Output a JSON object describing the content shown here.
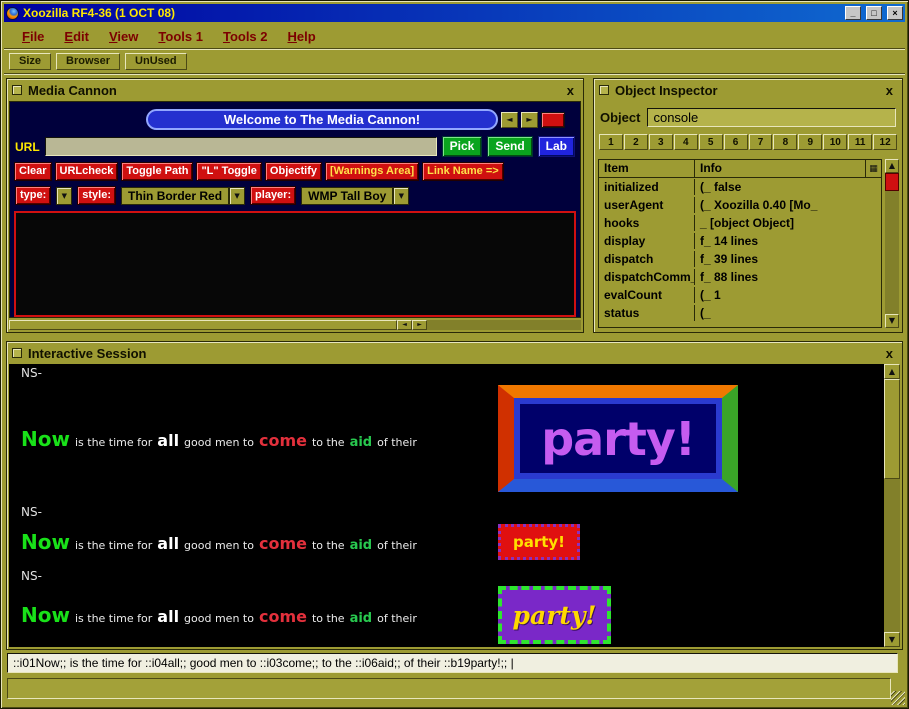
{
  "colors": {
    "desktop_olive": "#9d9b33",
    "titlebar_blue": "#0000a0",
    "accent_red": "#cf1010",
    "accent_green": "#0aa41e",
    "accent_blue": "#2024dd",
    "cannon_bg": "#00003c",
    "session_bg": "#000000"
  },
  "icons": {
    "minimize": "_",
    "maximize": "□",
    "close": "×",
    "panel_close": "x",
    "left": "◄",
    "right": "►",
    "up": "▲",
    "down": "▼",
    "grid": "▦",
    "dropdown": "▼"
  },
  "window": {
    "title": "Xoozilla RF4-36 (1 OCT 08)"
  },
  "menu": {
    "items": [
      "File",
      "Edit",
      "View",
      "Tools 1",
      "Tools 2",
      "Help"
    ]
  },
  "toolbar": {
    "buttons": [
      "Size",
      "Browser",
      "UnUsed"
    ]
  },
  "media_cannon": {
    "title": "Media Cannon",
    "welcome": "Welcome to The Media Cannon!",
    "url_label": "URL",
    "url_value": "",
    "pick": "Pick",
    "send": "Send",
    "lab": "Lab",
    "red_buttons": [
      "Clear",
      "URLcheck",
      "Toggle Path",
      "\"L\" Toggle",
      "Objectify",
      "[Warnings Area]",
      "Link Name =>"
    ],
    "type_label": "type:",
    "style_label": "style:",
    "style_value": "Thin Border Red",
    "player_label": "player:",
    "player_value": "WMP Tall Boy"
  },
  "object_inspector": {
    "title": "Object Inspector",
    "object_label": "Object",
    "object_value": "console",
    "tabs": [
      "1",
      "2",
      "3",
      "4",
      "5",
      "6",
      "7",
      "8",
      "9",
      "10",
      "11",
      "12"
    ],
    "col_item": "Item",
    "col_info": "Info",
    "rows": [
      {
        "item": "initialized",
        "info": "(_ false"
      },
      {
        "item": "userAgent",
        "info": "(_ Xoozilla 0.40 [Mo_"
      },
      {
        "item": "hooks",
        "info": "_  [object Object]"
      },
      {
        "item": "display",
        "info": "f_ 14 lines"
      },
      {
        "item": "dispatch",
        "info": "f_ 39 lines"
      },
      {
        "item": "dispatchComm_",
        "info": "f_ 88 lines"
      },
      {
        "item": "evalCount",
        "info": "(_ 1"
      },
      {
        "item": "status",
        "info": "(_"
      }
    ]
  },
  "session": {
    "title": "Interactive Session",
    "prompt": "NS-",
    "words": {
      "now": "Now",
      "seg1": "is the time for",
      "all": "all",
      "seg2": "good men to",
      "come": "come",
      "seg3": "to the",
      "aid": "aid",
      "seg4": "of their"
    },
    "party": "party!",
    "command": "::i01Now;; is the time for ::i04all;; good men to ::i03come;; to the ::i06aid;; of their ::b19party!;; |"
  }
}
